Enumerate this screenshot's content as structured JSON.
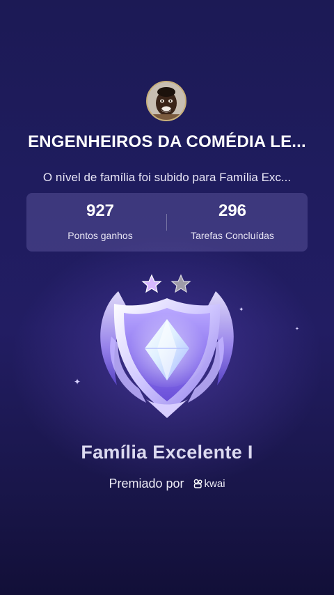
{
  "family": {
    "name": "ENGENHEIROS DA COMÉDIA LE...",
    "avatar_icon": "profile-avatar"
  },
  "message": "O nível de família foi subido para Família Exc...",
  "stats": [
    {
      "value": "927",
      "label": "Pontos ganhos"
    },
    {
      "value": "296",
      "label": "Tarefas Concluídas"
    }
  ],
  "badge": {
    "stars": 2,
    "icon": "crystal-shield-badge"
  },
  "level_title": "Família Excelente I",
  "awarded": {
    "label": "Premiado por",
    "brand": "kwai",
    "brand_icon": "kwai-logo-icon"
  },
  "colors": {
    "background": "#1f1c5e",
    "card": "#5b5495",
    "badge_accent": "#a890ff"
  }
}
